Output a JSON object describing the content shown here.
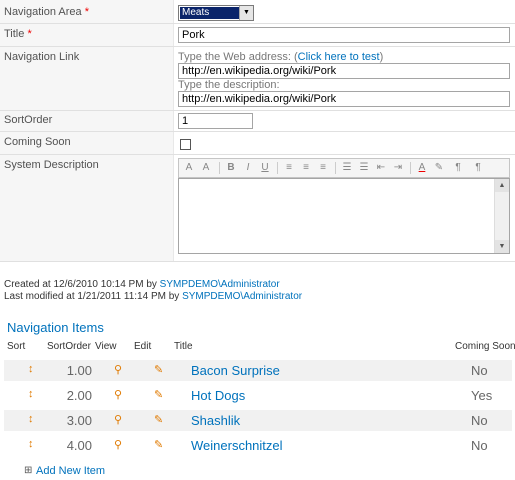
{
  "form": {
    "navigation_area": {
      "label": "Navigation Area",
      "required_mark": "*",
      "value": "Meats"
    },
    "title": {
      "label": "Title",
      "required_mark": "*",
      "value": "Pork"
    },
    "navigation_link": {
      "label": "Navigation Link",
      "web_address_hint_prefix": "Type the Web address: (",
      "test_link": "Click here to test",
      "web_address_hint_suffix": ")",
      "web_address_value": "http://en.wikipedia.org/wiki/Pork",
      "description_hint": "Type the description:",
      "description_value": "http://en.wikipedia.org/wiki/Pork"
    },
    "sort_order": {
      "label": "SortOrder",
      "value": "1"
    },
    "coming_soon": {
      "label": "Coming Soon",
      "checked": false
    },
    "system_description": {
      "label": "System Description",
      "value": ""
    }
  },
  "toolbar_icons": [
    "font-icon",
    "font-size-icon",
    "bold-icon",
    "italic-icon",
    "underline-icon",
    "align-left-icon",
    "align-center-icon",
    "align-right-icon",
    "numbered-list-icon",
    "bullet-list-icon",
    "outdent-icon",
    "indent-icon",
    "text-color-icon",
    "highlight-icon",
    "ltr-icon",
    "rtl-icon"
  ],
  "meta": {
    "created_prefix": "Created at 12/6/2010 10:14 PM  by ",
    "created_by": "SYMPDEMO\\Administrator",
    "modified_prefix": "Last modified at 1/21/2011 11:14 PM  by ",
    "modified_by": "SYMPDEMO\\Administrator"
  },
  "nav_items": {
    "title": "Navigation Items",
    "headers": {
      "sort": "Sort",
      "sort_order": "SortOrder",
      "view": "View",
      "edit": "Edit",
      "title": "Title",
      "coming_soon": "Coming Soon"
    },
    "rows": [
      {
        "sort_order": "1.00",
        "title": "Bacon Surprise",
        "coming_soon": "No"
      },
      {
        "sort_order": "2.00",
        "title": "Hot Dogs",
        "coming_soon": "Yes"
      },
      {
        "sort_order": "3.00",
        "title": "Shashlik",
        "coming_soon": "No"
      },
      {
        "sort_order": "4.00",
        "title": "Weinerschnitzel",
        "coming_soon": "No"
      }
    ],
    "add_new": "Add New Item"
  },
  "colors": {
    "link": "#0072bc",
    "icon_accent": "#e07a00",
    "alt_row": "#f1f1f1"
  }
}
